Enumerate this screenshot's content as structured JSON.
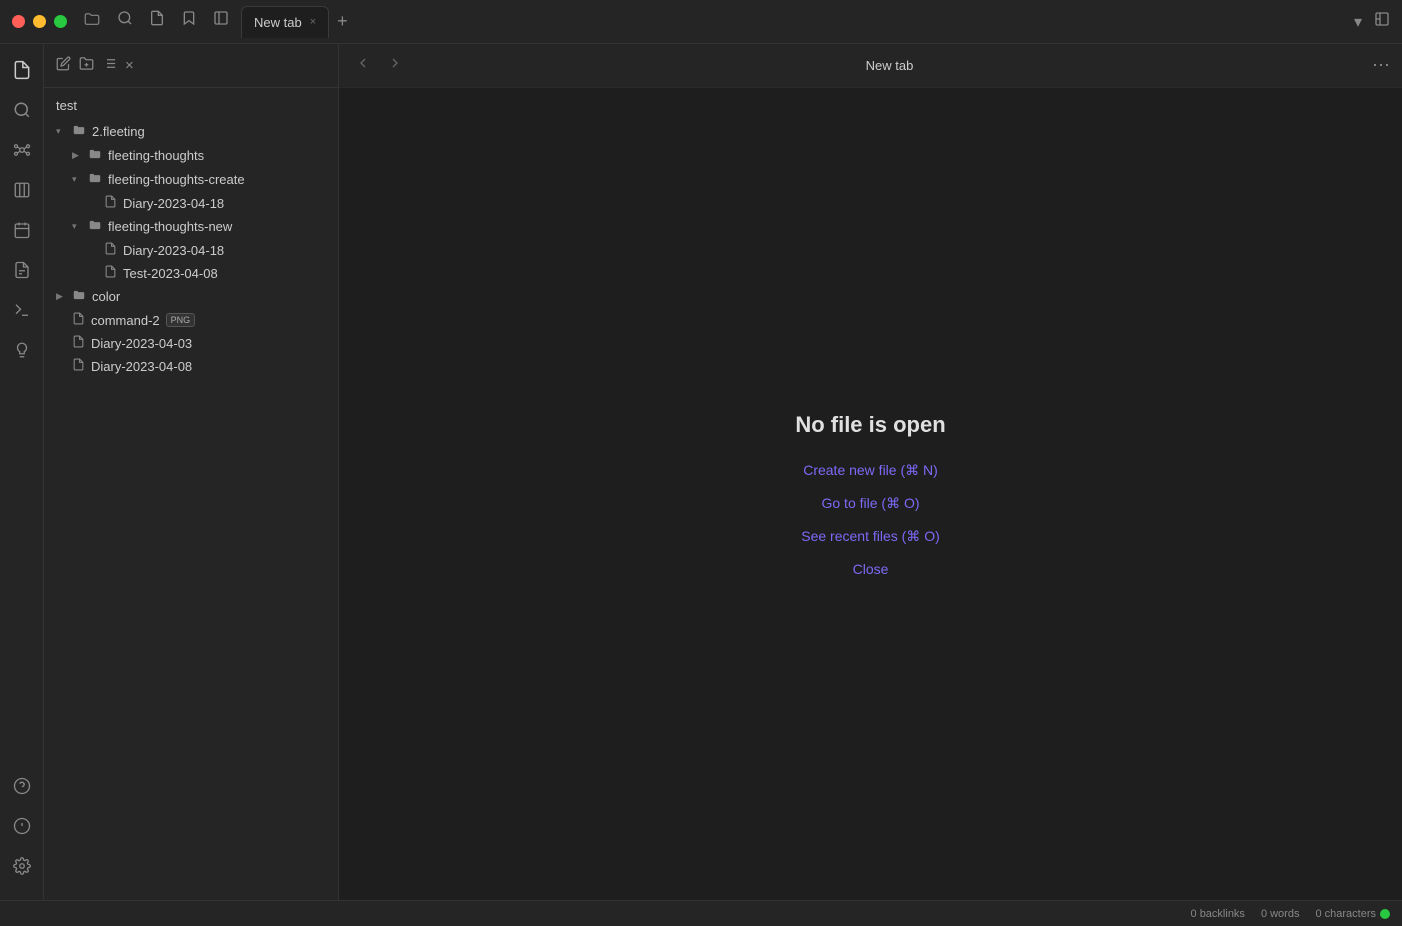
{
  "titlebar": {
    "tab_label": "New tab",
    "add_tab_label": "+",
    "close_tab_label": "×"
  },
  "sidebar": {
    "root_label": "test",
    "toolbar": {
      "new_note": "✏",
      "new_folder": "📁",
      "sort": "≡",
      "close": "×"
    },
    "tree": [
      {
        "id": "2fleeting",
        "label": "2.fleeting",
        "indent": 1,
        "type": "folder",
        "expanded": true,
        "arrow": "▾"
      },
      {
        "id": "fleeting-thoughts",
        "label": "fleeting-thoughts",
        "indent": 2,
        "type": "folder",
        "expanded": false,
        "arrow": "▶"
      },
      {
        "id": "fleeting-thoughts-create",
        "label": "fleeting-thoughts-create",
        "indent": 2,
        "type": "folder",
        "expanded": true,
        "arrow": "▾"
      },
      {
        "id": "diary-2023-04-18-a",
        "label": "Diary-2023-04-18",
        "indent": 3,
        "type": "file",
        "arrow": ""
      },
      {
        "id": "fleeting-thoughts-new",
        "label": "fleeting-thoughts-new",
        "indent": 2,
        "type": "folder",
        "expanded": true,
        "arrow": "▾"
      },
      {
        "id": "diary-2023-04-18-b",
        "label": "Diary-2023-04-18",
        "indent": 3,
        "type": "file",
        "arrow": ""
      },
      {
        "id": "test-2023-04-08",
        "label": "Test-2023-04-08",
        "indent": 3,
        "type": "file",
        "arrow": ""
      },
      {
        "id": "color",
        "label": "color",
        "indent": 1,
        "type": "folder",
        "expanded": false,
        "arrow": "▶"
      },
      {
        "id": "command-2",
        "label": "command-2",
        "indent": 1,
        "type": "file-png",
        "arrow": "",
        "badge": "PNG"
      },
      {
        "id": "diary-2023-04-03",
        "label": "Diary-2023-04-03",
        "indent": 1,
        "type": "file",
        "arrow": ""
      },
      {
        "id": "diary-2023-04-08",
        "label": "Diary-2023-04-08",
        "indent": 1,
        "type": "file",
        "arrow": ""
      }
    ]
  },
  "content": {
    "title": "New tab",
    "no_file_title": "No file is open",
    "actions": [
      {
        "id": "create-new",
        "label": "Create new file (⌘ N)"
      },
      {
        "id": "go-to-file",
        "label": "Go to file (⌘ O)"
      },
      {
        "id": "see-recent",
        "label": "See recent files (⌘ O)"
      },
      {
        "id": "close",
        "label": "Close"
      }
    ]
  },
  "statusbar": {
    "backlinks": "0 backlinks",
    "words": "0 words",
    "characters": "0 characters"
  },
  "activity_bar": {
    "top_icons": [
      {
        "id": "files",
        "symbol": "⊞"
      },
      {
        "id": "search",
        "symbol": "🔍"
      },
      {
        "id": "graph",
        "symbol": "⬡"
      },
      {
        "id": "kanban",
        "symbol": "⊟"
      },
      {
        "id": "calendar",
        "symbol": "▦"
      },
      {
        "id": "notes",
        "symbol": "⊡"
      },
      {
        "id": "terminal",
        "symbol": "⌨"
      },
      {
        "id": "bulb",
        "symbol": "💡"
      }
    ],
    "bottom_icons": [
      {
        "id": "help-circle",
        "symbol": "?"
      },
      {
        "id": "info",
        "symbol": "ℹ"
      },
      {
        "id": "settings",
        "symbol": "⚙"
      }
    ]
  }
}
